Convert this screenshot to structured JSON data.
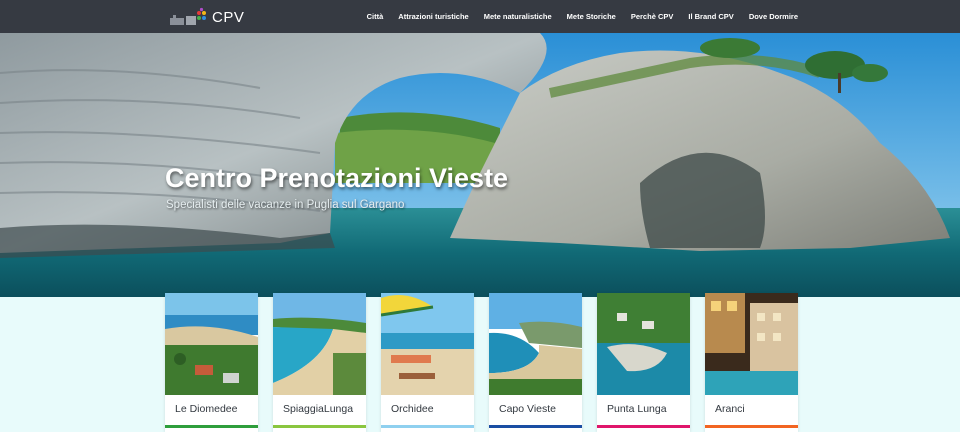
{
  "brand": {
    "name": "CPV",
    "logo_icon": "cpv-logo-icon"
  },
  "nav": {
    "items": [
      {
        "label": "Città"
      },
      {
        "label": "Attrazioni turistiche"
      },
      {
        "label": "Mete naturalistiche"
      },
      {
        "label": "Mete Storiche"
      },
      {
        "label": "Perchè CPV"
      },
      {
        "label": "Il Brand CPV"
      },
      {
        "label": "Dove Dormire"
      }
    ]
  },
  "hero": {
    "title": "Centro Prenotazioni Vieste",
    "subtitle": "Specialisti delle vacanze in Puglia sul Gargano"
  },
  "cards": [
    {
      "label": "Le Diomedee",
      "color": "#2e9e3c"
    },
    {
      "label": "SpiaggiaLunga",
      "color": "#8ac63f"
    },
    {
      "label": "Orchidee",
      "color": "#8fd0ef"
    },
    {
      "label": "Capo Vieste",
      "color": "#1a4ea3"
    },
    {
      "label": "Punta Lunga",
      "color": "#e0166b"
    },
    {
      "label": "Aranci",
      "color": "#f26522"
    }
  ],
  "colors": {
    "navbar": "#363a42",
    "page_background": "#e8fbfb"
  }
}
